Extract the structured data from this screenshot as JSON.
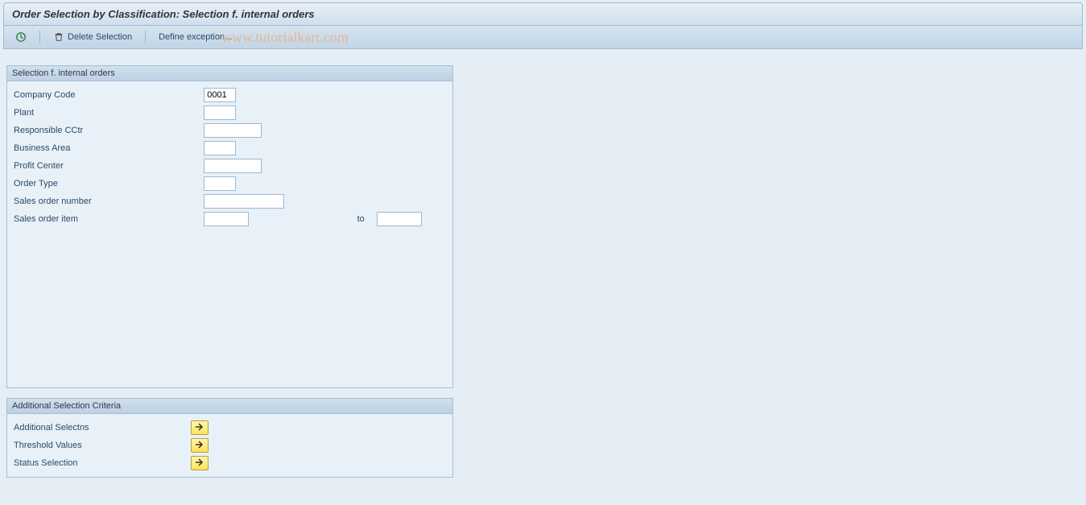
{
  "title": "Order Selection by Classification: Selection f. internal orders",
  "toolbar": {
    "delete_label": "Delete Selection",
    "define_label": "Define exception..."
  },
  "watermark": "www.tutorialkart.com",
  "panel1": {
    "header": "Selection f. internal orders",
    "fields": {
      "company_code_label": "Company Code",
      "company_code_value": "0001",
      "plant_label": "Plant",
      "plant_value": "",
      "resp_cctr_label": "Responsible CCtr",
      "resp_cctr_value": "",
      "business_area_label": "Business Area",
      "business_area_value": "",
      "profit_center_label": "Profit Center",
      "profit_center_value": "",
      "order_type_label": "Order Type",
      "order_type_value": "",
      "sales_order_number_label": "Sales order number",
      "sales_order_number_value": "",
      "sales_order_item_label": "Sales order item",
      "sales_order_item_value": "",
      "to_label": "to",
      "sales_order_item_to_value": ""
    }
  },
  "panel2": {
    "header": "Additional Selection Criteria",
    "rows": {
      "additional_selectns_label": "Additional Selectns",
      "threshold_values_label": "Threshold Values",
      "status_selection_label": "Status Selection"
    }
  }
}
